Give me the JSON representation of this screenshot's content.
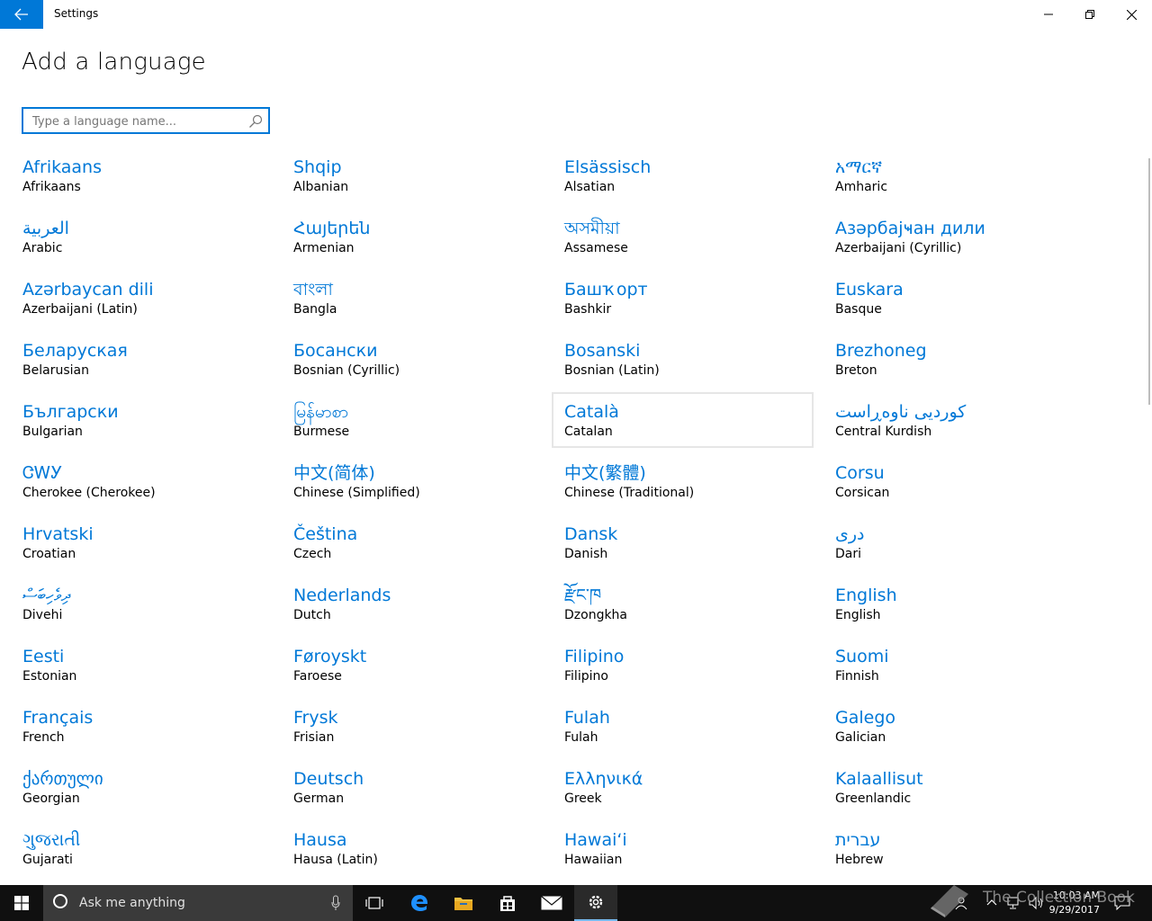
{
  "titlebar": {
    "title": "Settings"
  },
  "page": {
    "title": "Add a language"
  },
  "search": {
    "placeholder": "Type a language name..."
  },
  "languages": [
    {
      "native": "Afrikaans",
      "english": "Afrikaans"
    },
    {
      "native": "Shqip",
      "english": "Albanian"
    },
    {
      "native": "Elsässisch",
      "english": "Alsatian"
    },
    {
      "native": "አማርኛ",
      "english": "Amharic"
    },
    {
      "native": "العربية",
      "english": "Arabic"
    },
    {
      "native": "Հայերեն",
      "english": "Armenian"
    },
    {
      "native": "অসমীয়া",
      "english": "Assamese"
    },
    {
      "native": "Азәрбајҹан дили",
      "english": "Azerbaijani (Cyrillic)"
    },
    {
      "native": "Azərbaycan dili",
      "english": "Azerbaijani (Latin)"
    },
    {
      "native": "বাংলা",
      "english": "Bangla"
    },
    {
      "native": "Башҡорт",
      "english": "Bashkir"
    },
    {
      "native": "Euskara",
      "english": "Basque"
    },
    {
      "native": "Беларуская",
      "english": "Belarusian"
    },
    {
      "native": "Босански",
      "english": "Bosnian (Cyrillic)"
    },
    {
      "native": "Bosanski",
      "english": "Bosnian (Latin)"
    },
    {
      "native": "Brezhoneg",
      "english": "Breton"
    },
    {
      "native": "Български",
      "english": "Bulgarian"
    },
    {
      "native": "မြန်မာစာ",
      "english": "Burmese"
    },
    {
      "native": "Català",
      "english": "Catalan",
      "focused": true
    },
    {
      "native": "کوردیی ناوەڕاست",
      "english": "Central Kurdish"
    },
    {
      "native": "ᏣᎳᎩ",
      "english": "Cherokee (Cherokee)"
    },
    {
      "native": "中文(简体)",
      "english": "Chinese (Simplified)"
    },
    {
      "native": "中文(繁體)",
      "english": "Chinese (Traditional)"
    },
    {
      "native": "Corsu",
      "english": "Corsican"
    },
    {
      "native": "Hrvatski",
      "english": "Croatian"
    },
    {
      "native": "Čeština",
      "english": "Czech"
    },
    {
      "native": "Dansk",
      "english": "Danish"
    },
    {
      "native": "درى",
      "english": "Dari"
    },
    {
      "native": "ދިވެހިބަސް",
      "english": "Divehi"
    },
    {
      "native": "Nederlands",
      "english": "Dutch"
    },
    {
      "native": "རྫོང་ཁ",
      "english": "Dzongkha"
    },
    {
      "native": "English",
      "english": "English"
    },
    {
      "native": "Eesti",
      "english": "Estonian"
    },
    {
      "native": "Føroyskt",
      "english": "Faroese"
    },
    {
      "native": "Filipino",
      "english": "Filipino"
    },
    {
      "native": "Suomi",
      "english": "Finnish"
    },
    {
      "native": "Français",
      "english": "French"
    },
    {
      "native": "Frysk",
      "english": "Frisian"
    },
    {
      "native": "Fulah",
      "english": "Fulah"
    },
    {
      "native": "Galego",
      "english": "Galician"
    },
    {
      "native": "ქართული",
      "english": "Georgian"
    },
    {
      "native": "Deutsch",
      "english": "German"
    },
    {
      "native": "Ελληνικά",
      "english": "Greek"
    },
    {
      "native": "Kalaallisut",
      "english": "Greenlandic"
    },
    {
      "native": "ગુજરાતી",
      "english": "Gujarati"
    },
    {
      "native": "Hausa",
      "english": "Hausa (Latin)"
    },
    {
      "native": "Hawaiʻi",
      "english": "Hawaiian"
    },
    {
      "native": "עברית",
      "english": "Hebrew"
    }
  ],
  "taskbar": {
    "search_placeholder": "Ask me anything",
    "time": "10:03 AM",
    "date": "9/29/2017",
    "watermark": "The Collection Book"
  },
  "colors": {
    "accent": "#0078d7",
    "taskbar": "#101010"
  }
}
